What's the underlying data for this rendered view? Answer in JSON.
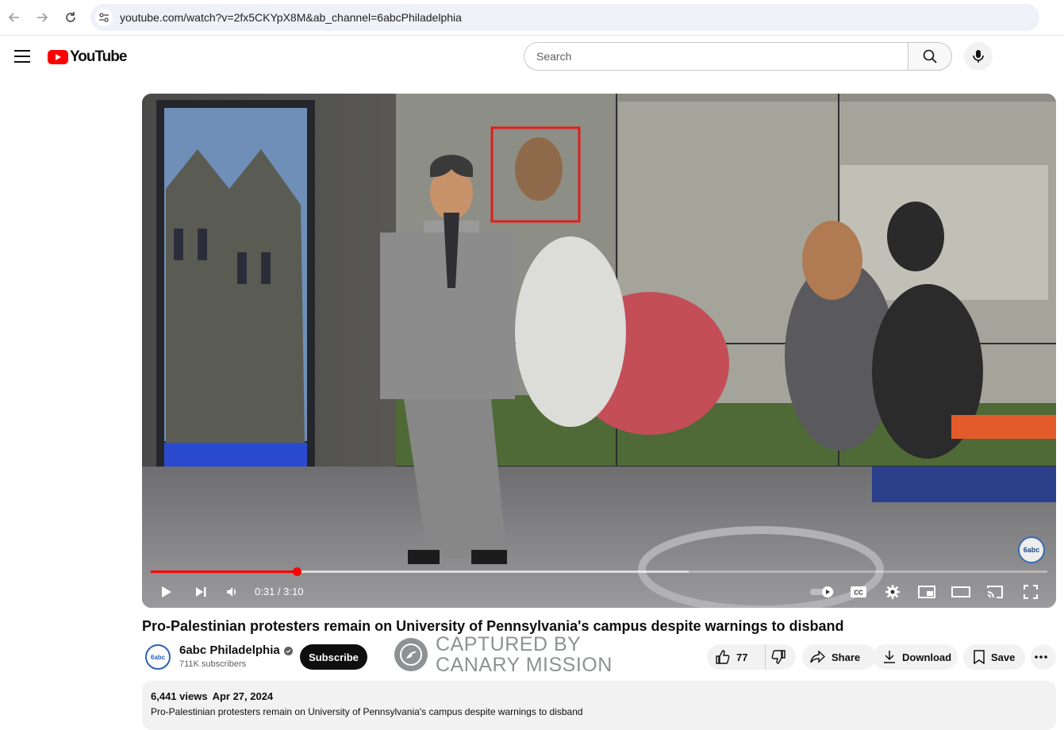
{
  "browser": {
    "url": "youtube.com/watch?v=2fx5CKYpX8M&ab_channel=6abcPhiladelphia"
  },
  "header": {
    "logo_text": "YouTube",
    "search_placeholder": "Search"
  },
  "player": {
    "current_time": "0:31",
    "duration": "3:10",
    "time_display": "0:31 / 3:10",
    "played_fraction": 0.163,
    "buffered_fraction": 0.6,
    "bug_text": "6abc"
  },
  "video": {
    "title": "Pro-Palestinian protesters remain on University of Pennsylvania's campus despite warnings to disband"
  },
  "channel": {
    "name": "6abc Philadelphia",
    "subscribers": "711K subscribers",
    "avatar_text": "6abc",
    "subscribe_label": "Subscribe"
  },
  "overlay": {
    "line1": "CAPTURED BY",
    "line2": "CANARY MISSION"
  },
  "actions": {
    "likes": "77",
    "share": "Share",
    "download": "Download",
    "save": "Save"
  },
  "description": {
    "views": "6,441 views",
    "date": "Apr 27, 2024",
    "text": "Pro-Palestinian protesters remain on University of Pennsylvania's campus despite warnings to disband"
  },
  "colors": {
    "accent": "#ff0000",
    "text": "#0f0f0f",
    "secondary": "#606060",
    "chip": "#f2f2f2"
  }
}
